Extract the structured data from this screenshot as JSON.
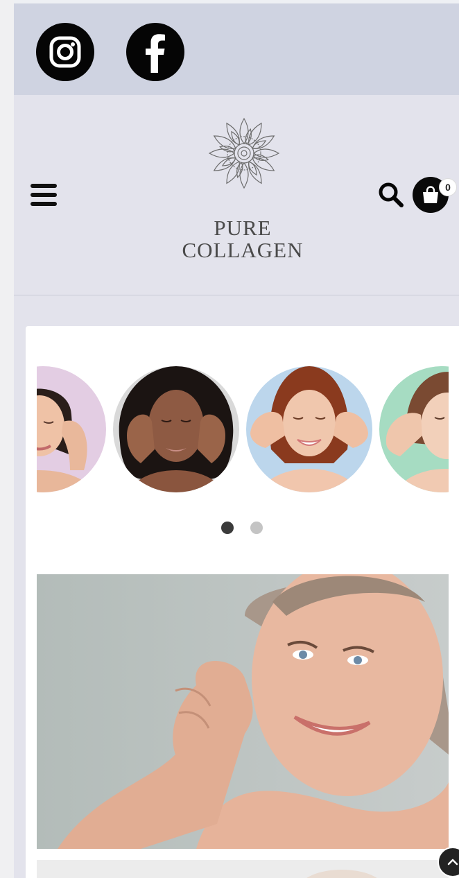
{
  "social": {
    "instagram_icon": "instagram-icon",
    "facebook_icon": "facebook-icon"
  },
  "header": {
    "brand_line1": "PURE",
    "brand_line2": "COLLAGEN",
    "cart_count": "0",
    "menu_icon": "menu-icon",
    "search_icon": "search-icon",
    "cart_icon": "shopping-bag-icon"
  },
  "carousel": {
    "active_page": 1,
    "page_count": 2
  },
  "colors": {
    "social_bar": "#cfd3e1",
    "header_bg": "#e3e3ec",
    "icon_dark": "#050505",
    "dot_active": "#3b3b3b",
    "dot_inactive": "#c4c4c4"
  }
}
